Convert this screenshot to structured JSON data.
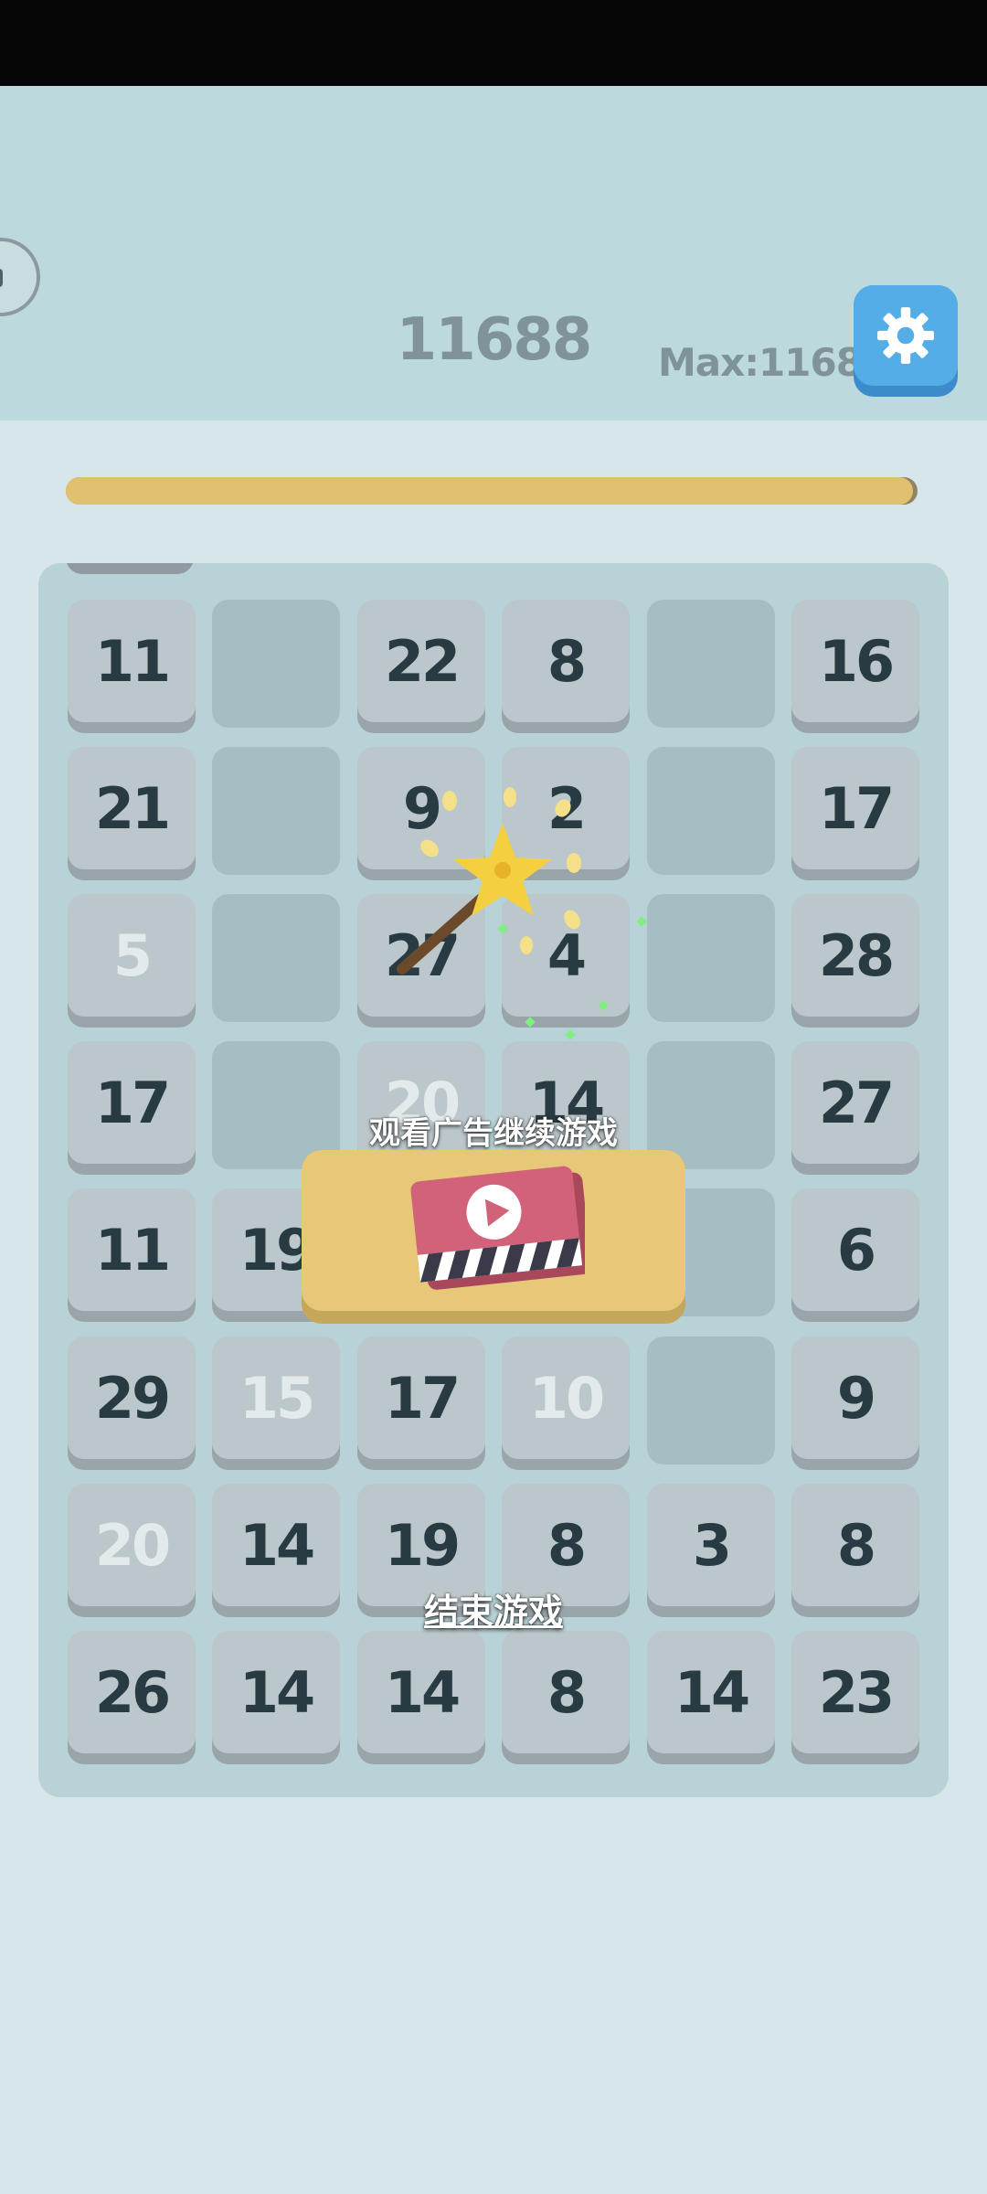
{
  "header": {
    "score": "11688",
    "max_score": "Max:11688",
    "settings_icon": "gear-icon",
    "avatar_icon": "face-icon"
  },
  "progress": {
    "fraction": 0.995,
    "fill_color": "#e0c170"
  },
  "board": {
    "rows": [
      [
        {
          "v": "11",
          "s": "normal"
        },
        {
          "v": "",
          "s": "empty"
        },
        {
          "v": "22",
          "s": "normal"
        },
        {
          "v": "8",
          "s": "normal"
        },
        {
          "v": "",
          "s": "empty"
        },
        {
          "v": "16",
          "s": "normal"
        }
      ],
      [
        {
          "v": "21",
          "s": "normal"
        },
        {
          "v": "",
          "s": "empty"
        },
        {
          "v": "9",
          "s": "normal"
        },
        {
          "v": "2",
          "s": "normal"
        },
        {
          "v": "",
          "s": "empty"
        },
        {
          "v": "17",
          "s": "normal"
        }
      ],
      [
        {
          "v": "5",
          "s": "faded"
        },
        {
          "v": "",
          "s": "empty"
        },
        {
          "v": "27",
          "s": "normal"
        },
        {
          "v": "4",
          "s": "normal"
        },
        {
          "v": "",
          "s": "empty"
        },
        {
          "v": "28",
          "s": "normal"
        }
      ],
      [
        {
          "v": "17",
          "s": "normal"
        },
        {
          "v": "",
          "s": "empty"
        },
        {
          "v": "20",
          "s": "faded"
        },
        {
          "v": "14",
          "s": "normal"
        },
        {
          "v": "",
          "s": "empty"
        },
        {
          "v": "27",
          "s": "normal"
        }
      ],
      [
        {
          "v": "11",
          "s": "normal"
        },
        {
          "v": "19",
          "s": "normal"
        },
        {
          "v": "",
          "s": "hidden"
        },
        {
          "v": "",
          "s": "hidden"
        },
        {
          "v": "",
          "s": "empty"
        },
        {
          "v": "6",
          "s": "normal"
        }
      ],
      [
        {
          "v": "29",
          "s": "normal"
        },
        {
          "v": "15",
          "s": "faded"
        },
        {
          "v": "17",
          "s": "normal"
        },
        {
          "v": "10",
          "s": "faded"
        },
        {
          "v": "",
          "s": "empty"
        },
        {
          "v": "9",
          "s": "normal"
        }
      ],
      [
        {
          "v": "20",
          "s": "faded"
        },
        {
          "v": "14",
          "s": "normal"
        },
        {
          "v": "19",
          "s": "normal"
        },
        {
          "v": "8",
          "s": "normal"
        },
        {
          "v": "3",
          "s": "normal"
        },
        {
          "v": "8",
          "s": "normal"
        }
      ],
      [
        {
          "v": "26",
          "s": "normal"
        },
        {
          "v": "14",
          "s": "normal"
        },
        {
          "v": "14",
          "s": "normal"
        },
        {
          "v": "8",
          "s": "normal"
        },
        {
          "v": "14",
          "s": "normal"
        },
        {
          "v": "23",
          "s": "normal"
        }
      ]
    ]
  },
  "overlay": {
    "wand_icon": "magic-wand-icon",
    "continue_label": "观看广告继续游戏",
    "ad_icon": "video-clapper-play-icon",
    "end_label": "结束游戏"
  },
  "colors": {
    "background": "#d7e6e9",
    "header": "#bcd9de",
    "tile": "#bcc7cb",
    "tile_text": "#283a42",
    "settings_button": "#55ade8",
    "ad_button": "#e6c878",
    "clapper": "#d2627a"
  }
}
